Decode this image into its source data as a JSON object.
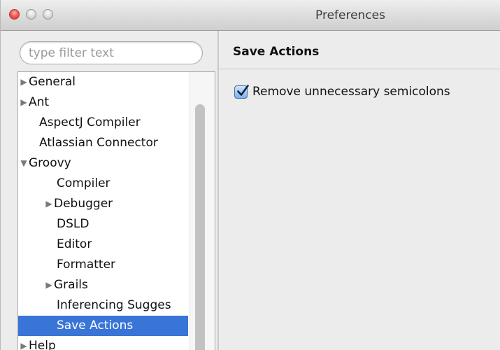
{
  "window": {
    "title": "Preferences"
  },
  "filter": {
    "placeholder": "type filter text"
  },
  "tree": {
    "items": [
      {
        "label": "General",
        "expander": "▶",
        "depth": 0
      },
      {
        "label": "Ant",
        "expander": "▶",
        "depth": 0
      },
      {
        "label": "AspectJ Compiler",
        "expander": "",
        "depth": 0
      },
      {
        "label": "Atlassian Connector",
        "expander": "",
        "depth": 0
      },
      {
        "label": "Groovy",
        "expander": "▼",
        "depth": 0
      },
      {
        "label": "Compiler",
        "expander": "",
        "depth": 1
      },
      {
        "label": "Debugger",
        "expander": "▶",
        "depth": 1
      },
      {
        "label": "DSLD",
        "expander": "",
        "depth": 1
      },
      {
        "label": "Editor",
        "expander": "",
        "depth": 1
      },
      {
        "label": "Formatter",
        "expander": "",
        "depth": 1
      },
      {
        "label": "Grails",
        "expander": "▶",
        "depth": 1
      },
      {
        "label": "Inferencing Sugges",
        "expander": "",
        "depth": 1
      },
      {
        "label": "Save Actions",
        "expander": "",
        "depth": 1,
        "selected": true
      },
      {
        "label": "Help",
        "expander": "▶",
        "depth": 0
      }
    ]
  },
  "content": {
    "section_title": "Save Actions",
    "option": {
      "label": "Remove unnecessary semicolons",
      "checked": true
    }
  },
  "colors": {
    "selection": "#3875d7",
    "close_button": "#f25c54"
  }
}
